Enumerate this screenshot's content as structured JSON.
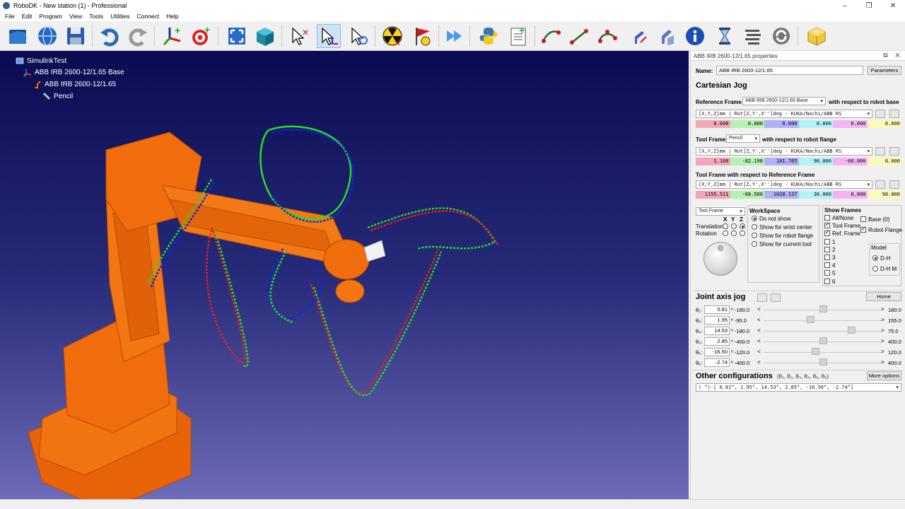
{
  "window": {
    "title": "RoboDK - New station (1) - Professional",
    "controls": [
      "–",
      "❐",
      "✕"
    ]
  },
  "menu": [
    "File",
    "Edit",
    "Program",
    "View",
    "Tools",
    "Utilities",
    "Connect",
    "Help"
  ],
  "toolbar_icons": [
    "open-icon",
    "globe-icon",
    "save-icon",
    "undo-icon",
    "redo-icon",
    "add-reference-frame-icon",
    "add-target-icon",
    "fit-all-icon",
    "isometric-view-icon",
    "select-icon",
    "move-reference-icon",
    "move-tool-icon",
    "collision-icon",
    "flag-icon",
    "fast-forward-icon",
    "python-icon",
    "add-program-icon",
    "move-joint-icon",
    "move-linear-icon",
    "move-circular-icon",
    "robot-machining-icon",
    "robot-tool-icon",
    "info-icon",
    "hourglass-icon",
    "settings-icon",
    "loop-icon",
    "package-icon"
  ],
  "tree": [
    {
      "label": "SimulinkTest",
      "icon": "station-icon"
    },
    {
      "label": "ABB IRB 2600-12/1.65 Base",
      "icon": "reference-frame-icon"
    },
    {
      "label": "ABB IRB 2600-12/1.65",
      "icon": "robot-icon"
    },
    {
      "label": "Pencil",
      "icon": "tool-icon"
    }
  ],
  "panel": {
    "title": "ABB IRB 2600-12/1.65 properties",
    "name_label": "Name:",
    "name_value": "ABB IRB 2600-12/1.65",
    "parameters": "Parameters",
    "cartesian_jog": "Cartesian Jog",
    "ref_frame_label": "Reference Frame",
    "ref_frame_value": "ABB IRB 2600-12/1.65 Base",
    "ref_frame_suffix": "with respect to robot base",
    "format": "[X,Y,Z]mm | Rot[Z,Y',X'']deg - KUKA/Nachi/ABB RS",
    "ref_values": [
      "0.000",
      "0.000",
      "0.000",
      "0.000",
      "0.000",
      "0.000"
    ],
    "tool_frame_label": "Tool Frame",
    "tool_frame_value": "Pencil",
    "tool_frame_suffix": "with respect to robot flange",
    "tool_values": [
      "1.160",
      "-82.198",
      "101.785",
      "90.000",
      "-60.000",
      "0.000"
    ],
    "tool_ref_label": "Tool Frame with respect to Reference Frame",
    "tool_ref_values": [
      "1155.511",
      "-68.500",
      "1028.137",
      "30.000",
      "0.000",
      "90.000"
    ],
    "jog_frame": "Tool Frame",
    "xyz": [
      "X",
      "Y",
      "Z"
    ],
    "translation": "Translation",
    "rotation": "Rotation",
    "workspace": {
      "title": "WorkSpace",
      "options": [
        "Do not show",
        "Show for wrist center",
        "Show for robot flange",
        "Show for current tool"
      ],
      "selected": 0
    },
    "show_frames": {
      "title": "Show Frames",
      "all_none": "All/None",
      "tool_frame": "Tool Frame",
      "ref_frame": "Ref. Frame",
      "numbers": [
        "1",
        "2",
        "3",
        "4",
        "5",
        "6"
      ],
      "base": "Base (0)",
      "robot_flange": "Robot Flange"
    },
    "model": {
      "title": "Model",
      "options": [
        "D-H",
        "D-H M"
      ],
      "selected": 0
    },
    "joint_jog": "Joint axis jog",
    "home": "Home",
    "joints": [
      {
        "label": "θ₁:",
        "value": "0.81",
        "min": "-180.0",
        "max": "180.0",
        "frac": 0.5
      },
      {
        "label": "θ₂:",
        "value": "1.95",
        "min": "-95.0",
        "max": "155.0",
        "frac": 0.39
      },
      {
        "label": "θ₃:",
        "value": "14.53",
        "min": "-180.0",
        "max": "75.0",
        "frac": 0.76
      },
      {
        "label": "θ₄:",
        "value": "2.85",
        "min": "-400.0",
        "max": "400.0",
        "frac": 0.5
      },
      {
        "label": "θ₅:",
        "value": "-16.50",
        "min": "-120.0",
        "max": "120.0",
        "frac": 0.43
      },
      {
        "label": "θ₆:",
        "value": "-2.74",
        "min": "-400.0",
        "max": "400.0",
        "frac": 0.5
      }
    ],
    "deg_symbol": "º",
    "lt": "<",
    "gt": ">",
    "other_configs": "Other configurations",
    "other_configs_hint": "(θ₁, θ₂, θ₃, θ₄, θ₅, θ₆)",
    "more_options": "More options",
    "config_value": "( °)-[   0.81°,    1.95°,   14.53°,    2.85°,  -16.50°,   -2.74°]"
  },
  "colors": {
    "robot": "#f06c0c",
    "viewport_top": "#0b0b52",
    "viewport_bottom": "#6e6bb8",
    "trail_red": "#e0202a",
    "trail_green": "#22e022",
    "trail_blue": "#1a22e0"
  }
}
